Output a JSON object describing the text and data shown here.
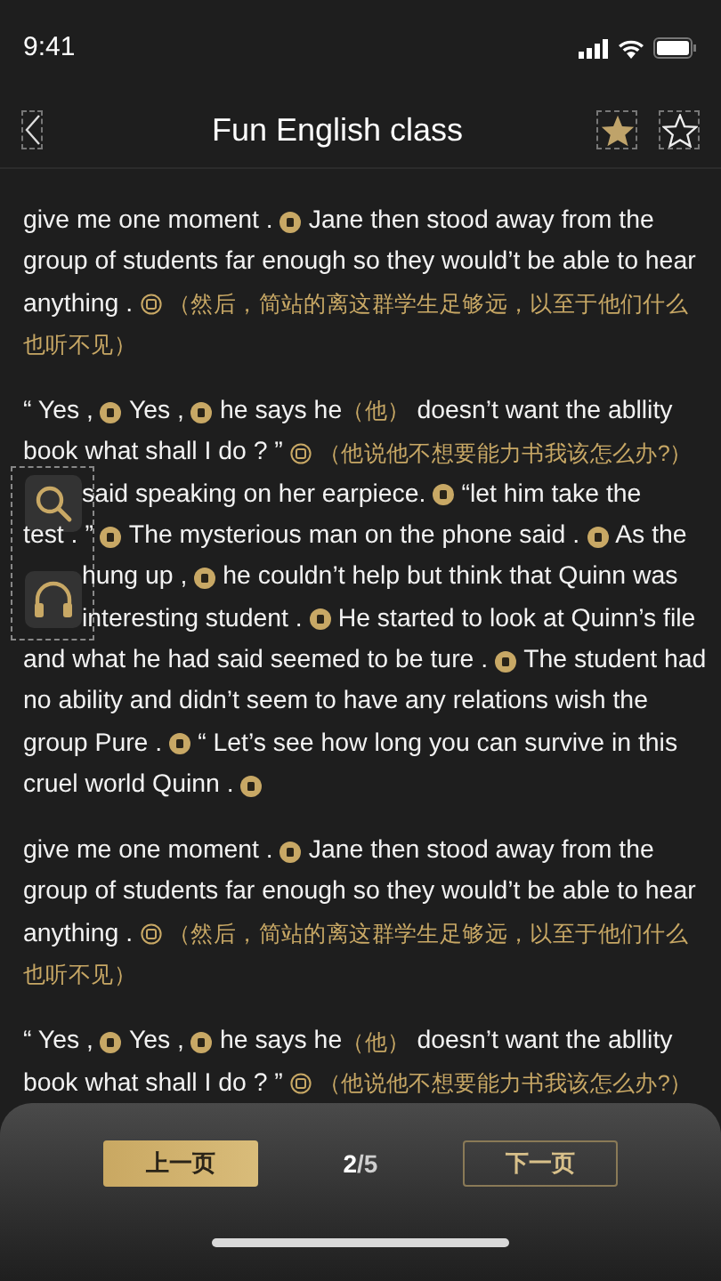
{
  "status_bar": {
    "time": "9:41"
  },
  "nav": {
    "title": "Fun English class"
  },
  "paragraphs": [
    {
      "lines": [
        {
          "cut": false,
          "segs": [
            {
              "kind": "english",
              "t": "give me one moment ."
            },
            {
              "kind": "mark",
              "expanded": false
            },
            {
              "kind": "english",
              "t": "Jane then stood away from the"
            }
          ]
        },
        {
          "cut": false,
          "segs": [
            {
              "kind": "english",
              "t": "group of students far enough so they would’t be able to hear"
            }
          ]
        },
        {
          "cut": false,
          "segs": [
            {
              "kind": "english",
              "t": "anything ."
            },
            {
              "kind": "mark",
              "expanded": true
            },
            {
              "kind": "chinese",
              "t": "（然后，简站的离这群学生足够远，以至于他们什么"
            }
          ]
        },
        {
          "cut": false,
          "segs": [
            {
              "kind": "chinese",
              "t": "也听不见）"
            }
          ]
        }
      ]
    },
    {
      "lines": [
        {
          "cut": false,
          "segs": [
            {
              "kind": "english",
              "t": "“ Yes ,"
            },
            {
              "kind": "mark",
              "expanded": false
            },
            {
              "kind": "english",
              "t": "Yes ,"
            },
            {
              "kind": "mark",
              "expanded": false
            },
            {
              "kind": "english",
              "t": "he says he"
            },
            {
              "kind": "chinese",
              "t": "（他）"
            },
            {
              "kind": "english",
              "t": "doesn’t want the abllity"
            }
          ]
        },
        {
          "cut": false,
          "segs": [
            {
              "kind": "english",
              "t": "book what shall I do ? ”"
            },
            {
              "kind": "mark",
              "expanded": true
            },
            {
              "kind": "chinese",
              "t": "（他说他不想要能力书我该怎么办?）"
            }
          ]
        },
        {
          "cut": true,
          "segs": [
            {
              "kind": "english",
              "t": "said speaking on her earpiece."
            },
            {
              "kind": "mark",
              "expanded": false
            },
            {
              "kind": "english",
              "t": "“let him take the"
            }
          ]
        },
        {
          "cut": false,
          "segs": [
            {
              "kind": "english",
              "t": "test . ”"
            },
            {
              "kind": "mark",
              "expanded": false
            },
            {
              "kind": "english",
              "t": "The mysterious man on the phone said ."
            },
            {
              "kind": "mark",
              "expanded": false
            },
            {
              "kind": "english",
              "t": "As the"
            }
          ]
        },
        {
          "cut": true,
          "segs": [
            {
              "kind": "english",
              "t": "hung up ,"
            },
            {
              "kind": "mark",
              "expanded": false
            },
            {
              "kind": "english",
              "t": "he couldn’t help but think that Quinn was"
            }
          ]
        },
        {
          "cut": true,
          "segs": [
            {
              "kind": "english",
              "t": "interesting student ."
            },
            {
              "kind": "mark",
              "expanded": false
            },
            {
              "kind": "english",
              "t": "He started to look at Quinn’s file"
            }
          ]
        },
        {
          "cut": false,
          "segs": [
            {
              "kind": "english",
              "t": "and what he had said seemed to be ture ."
            },
            {
              "kind": "mark",
              "expanded": false
            },
            {
              "kind": "english",
              "t": "The student had"
            }
          ]
        },
        {
          "cut": false,
          "segs": [
            {
              "kind": "english",
              "t": "no ability and didn’t seem to have any relations wish the"
            }
          ]
        },
        {
          "cut": false,
          "segs": [
            {
              "kind": "english",
              "t": "group Pure ."
            },
            {
              "kind": "mark",
              "expanded": false
            },
            {
              "kind": "english",
              "t": "“ Let’s see how long you can survive in this"
            }
          ]
        },
        {
          "cut": false,
          "segs": [
            {
              "kind": "english",
              "t": "cruel world Quinn ."
            },
            {
              "kind": "mark",
              "expanded": false
            }
          ]
        }
      ]
    },
    {
      "lines": [
        {
          "cut": false,
          "segs": [
            {
              "kind": "english",
              "t": "give me one moment ."
            },
            {
              "kind": "mark",
              "expanded": false
            },
            {
              "kind": "english",
              "t": "Jane then stood away from the"
            }
          ]
        },
        {
          "cut": false,
          "segs": [
            {
              "kind": "english",
              "t": "group of students far enough so they would’t be able to hear"
            }
          ]
        },
        {
          "cut": false,
          "segs": [
            {
              "kind": "english",
              "t": "anything ."
            },
            {
              "kind": "mark",
              "expanded": true
            },
            {
              "kind": "chinese",
              "t": "（然后，简站的离这群学生足够远，以至于他们什么"
            }
          ]
        },
        {
          "cut": false,
          "segs": [
            {
              "kind": "chinese",
              "t": "也听不见）"
            }
          ]
        }
      ]
    },
    {
      "lines": [
        {
          "cut": false,
          "segs": [
            {
              "kind": "english",
              "t": "“ Yes ,"
            },
            {
              "kind": "mark",
              "expanded": false
            },
            {
              "kind": "english",
              "t": "Yes ,"
            },
            {
              "kind": "mark",
              "expanded": false
            },
            {
              "kind": "english",
              "t": "he says he"
            },
            {
              "kind": "chinese",
              "t": "（他）"
            },
            {
              "kind": "english",
              "t": "doesn’t want the abllity"
            }
          ]
        },
        {
          "cut": false,
          "segs": [
            {
              "kind": "english",
              "t": "book what shall I do ? ”"
            },
            {
              "kind": "mark",
              "expanded": true
            },
            {
              "kind": "chinese",
              "t": "（他说他不想要能力书我该怎么办?）"
            }
          ]
        }
      ]
    }
  ],
  "pager": {
    "prev": {
      "label": "上一页",
      "selected": true
    },
    "current": "2",
    "rest": "/5",
    "next": {
      "label": "下一页",
      "selected": false
    }
  }
}
